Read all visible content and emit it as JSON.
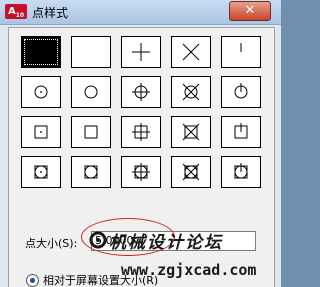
{
  "window": {
    "title": "点样式",
    "app_icon_text": "A"
  },
  "point_styles": [
    "dot",
    "none",
    "plus",
    "x",
    "tick",
    "circle-dot",
    "circle",
    "circle-plus",
    "circle-x",
    "circle-tick",
    "square-dot",
    "square",
    "square-plus",
    "square-x",
    "square-tick",
    "square-circle-dot",
    "square-circle",
    "square-circle-plus",
    "square-circle-x",
    "square-circle-tick"
  ],
  "selected_style": 0,
  "point_size": {
    "label": "点大小(S):",
    "value": "5.0000"
  },
  "radio": {
    "label": "相对于屏幕设置大小(R)"
  },
  "watermark": {
    "text": "机械设计论坛",
    "url": "www.zgjxcad.com"
  },
  "colors": {
    "oval": "#d02020",
    "selected": "#000000"
  }
}
